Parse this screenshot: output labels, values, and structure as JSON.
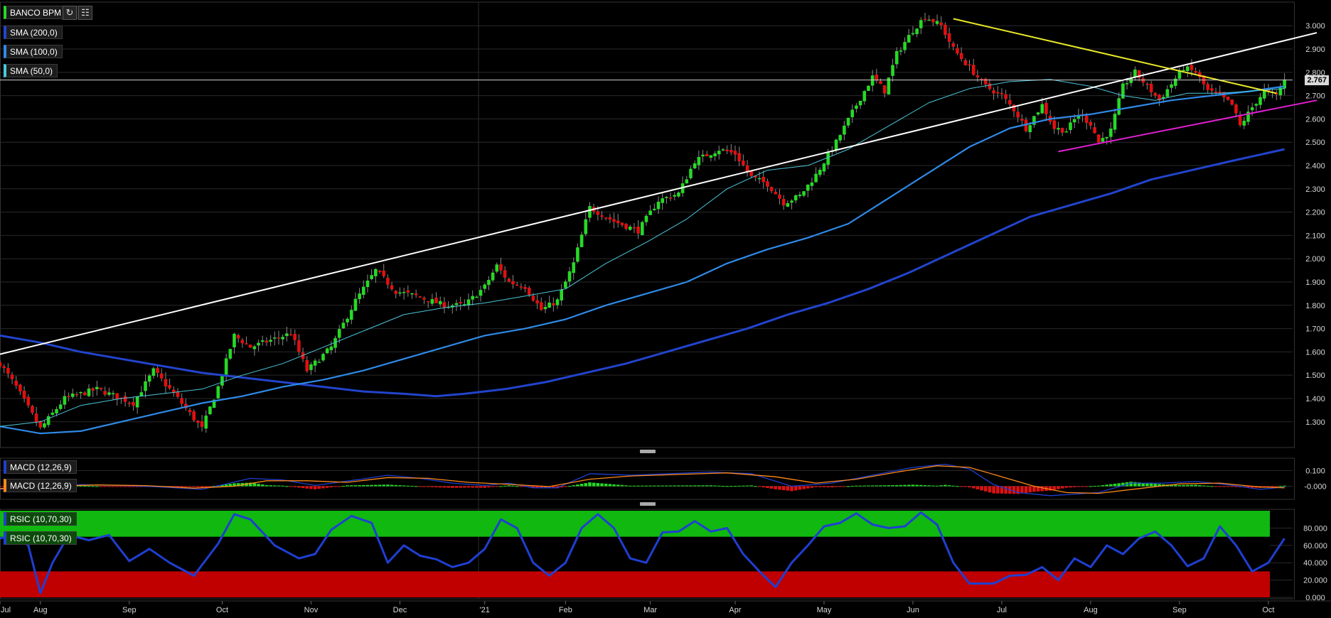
{
  "instrument": "BANCO BPM",
  "indicators": {
    "sma200": "SMA (200,0)",
    "sma100": "SMA (100,0)",
    "sma50": "SMA (50,0)",
    "macd_a": "MACD (12,26,9)",
    "macd_b": "MACD (12,26,9)",
    "rsi_a": "RSIC (10,70,30)",
    "rsi_b": "RSIC (10,70,30)"
  },
  "toolbar": {
    "refresh_icon": "refresh-icon",
    "chart_icon": "bar-chart-icon"
  },
  "last_price": "2.767",
  "colors": {
    "background": "#000000",
    "grid": "#2a2a2a",
    "up": "#26d926",
    "down": "#e01010",
    "sma50": "#4cc7d9",
    "sma100": "#2f8ae8",
    "sma200": "#2244cc",
    "trend_white": "#ffffff",
    "trend_yellow": "#e8e82a",
    "trend_magenta": "#e020d0",
    "macd": "#1f3fd1",
    "signal": "#ff8a1a",
    "rsi": "#1f3fd1",
    "rsi_overbought": "#10b810",
    "rsi_oversold": "#c00000"
  },
  "chart_data": [
    {
      "type": "candlestick",
      "title": "BANCO BPM",
      "ylim": [
        1.22,
        3.08
      ],
      "yticks": [
        "1.300",
        "1.400",
        "1.500",
        "1.600",
        "1.700",
        "1.800",
        "1.900",
        "2.000",
        "2.100",
        "2.200",
        "2.300",
        "2.400",
        "2.500",
        "2.600",
        "2.700",
        "2.800",
        "2.900",
        "3.000"
      ],
      "xticks": [
        "Jul",
        "Aug",
        "Sep",
        "Oct",
        "Nov",
        "Dec",
        "'21",
        "Feb",
        "Mar",
        "Apr",
        "May",
        "Jun",
        "Jul",
        "Aug",
        "Sep",
        "Oct"
      ],
      "x_range": [
        0,
        320
      ],
      "xtick_positions": [
        0,
        10,
        32,
        55,
        77,
        99,
        120,
        140,
        161,
        182,
        204,
        226,
        248,
        270,
        292,
        314
      ],
      "anchors": [
        [
          0,
          1.55
        ],
        [
          4,
          1.45
        ],
        [
          10,
          1.27
        ],
        [
          16,
          1.4
        ],
        [
          24,
          1.44
        ],
        [
          33,
          1.38
        ],
        [
          38,
          1.52
        ],
        [
          44,
          1.4
        ],
        [
          50,
          1.27
        ],
        [
          54,
          1.45
        ],
        [
          58,
          1.67
        ],
        [
          62,
          1.62
        ],
        [
          67,
          1.65
        ],
        [
          72,
          1.68
        ],
        [
          76,
          1.52
        ],
        [
          82,
          1.62
        ],
        [
          88,
          1.82
        ],
        [
          93,
          1.95
        ],
        [
          98,
          1.86
        ],
        [
          103,
          1.84
        ],
        [
          110,
          1.8
        ],
        [
          115,
          1.8
        ],
        [
          120,
          1.88
        ],
        [
          123,
          1.97
        ],
        [
          126,
          1.9
        ],
        [
          130,
          1.88
        ],
        [
          134,
          1.78
        ],
        [
          138,
          1.82
        ],
        [
          142,
          1.98
        ],
        [
          146,
          2.22
        ],
        [
          152,
          2.16
        ],
        [
          158,
          2.12
        ],
        [
          163,
          2.25
        ],
        [
          168,
          2.28
        ],
        [
          172,
          2.42
        ],
        [
          178,
          2.47
        ],
        [
          182,
          2.45
        ],
        [
          186,
          2.35
        ],
        [
          190,
          2.32
        ],
        [
          194,
          2.24
        ],
        [
          198,
          2.27
        ],
        [
          202,
          2.36
        ],
        [
          207,
          2.5
        ],
        [
          212,
          2.66
        ],
        [
          216,
          2.78
        ],
        [
          219,
          2.72
        ],
        [
          222,
          2.88
        ],
        [
          226,
          2.98
        ],
        [
          229,
          3.04
        ],
        [
          233,
          3.0
        ],
        [
          236,
          2.9
        ],
        [
          240,
          2.82
        ],
        [
          244,
          2.74
        ],
        [
          248,
          2.7
        ],
        [
          251,
          2.64
        ],
        [
          254,
          2.56
        ],
        [
          258,
          2.66
        ],
        [
          261,
          2.56
        ],
        [
          264,
          2.55
        ],
        [
          267,
          2.62
        ],
        [
          270,
          2.58
        ],
        [
          272,
          2.5
        ],
        [
          275,
          2.55
        ],
        [
          278,
          2.74
        ],
        [
          281,
          2.8
        ],
        [
          284,
          2.74
        ],
        [
          287,
          2.68
        ],
        [
          290,
          2.75
        ],
        [
          293,
          2.82
        ],
        [
          296,
          2.8
        ],
        [
          299,
          2.72
        ],
        [
          302,
          2.7
        ],
        [
          305,
          2.66
        ],
        [
          307,
          2.57
        ],
        [
          310,
          2.65
        ],
        [
          313,
          2.72
        ],
        [
          316,
          2.7
        ],
        [
          318,
          2.767
        ]
      ],
      "sma50_points": [
        [
          0,
          1.28
        ],
        [
          10,
          1.3
        ],
        [
          20,
          1.37
        ],
        [
          30,
          1.4
        ],
        [
          40,
          1.42
        ],
        [
          50,
          1.44
        ],
        [
          60,
          1.5
        ],
        [
          70,
          1.55
        ],
        [
          80,
          1.62
        ],
        [
          90,
          1.69
        ],
        [
          100,
          1.76
        ],
        [
          110,
          1.79
        ],
        [
          120,
          1.81
        ],
        [
          130,
          1.84
        ],
        [
          140,
          1.87
        ],
        [
          150,
          1.98
        ],
        [
          160,
          2.07
        ],
        [
          170,
          2.17
        ],
        [
          180,
          2.3
        ],
        [
          190,
          2.38
        ],
        [
          200,
          2.4
        ],
        [
          210,
          2.47
        ],
        [
          220,
          2.57
        ],
        [
          230,
          2.67
        ],
        [
          240,
          2.73
        ],
        [
          250,
          2.76
        ],
        [
          260,
          2.77
        ],
        [
          270,
          2.74
        ],
        [
          278,
          2.7
        ],
        [
          286,
          2.68
        ],
        [
          294,
          2.71
        ],
        [
          302,
          2.71
        ],
        [
          310,
          2.72
        ],
        [
          318,
          2.73
        ]
      ],
      "sma100_points": [
        [
          0,
          1.28
        ],
        [
          10,
          1.25
        ],
        [
          20,
          1.26
        ],
        [
          30,
          1.3
        ],
        [
          40,
          1.34
        ],
        [
          50,
          1.38
        ],
        [
          60,
          1.41
        ],
        [
          70,
          1.45
        ],
        [
          80,
          1.48
        ],
        [
          90,
          1.52
        ],
        [
          100,
          1.57
        ],
        [
          110,
          1.62
        ],
        [
          120,
          1.67
        ],
        [
          130,
          1.7
        ],
        [
          140,
          1.74
        ],
        [
          150,
          1.8
        ],
        [
          160,
          1.85
        ],
        [
          170,
          1.9
        ],
        [
          180,
          1.98
        ],
        [
          190,
          2.04
        ],
        [
          200,
          2.09
        ],
        [
          210,
          2.15
        ],
        [
          220,
          2.26
        ],
        [
          230,
          2.37
        ],
        [
          240,
          2.48
        ],
        [
          250,
          2.56
        ],
        [
          260,
          2.6
        ],
        [
          270,
          2.62
        ],
        [
          280,
          2.65
        ],
        [
          290,
          2.68
        ],
        [
          300,
          2.7
        ],
        [
          310,
          2.72
        ],
        [
          318,
          2.74
        ]
      ],
      "sma200_points": [
        [
          0,
          1.67
        ],
        [
          10,
          1.64
        ],
        [
          20,
          1.6
        ],
        [
          30,
          1.57
        ],
        [
          40,
          1.54
        ],
        [
          50,
          1.51
        ],
        [
          60,
          1.49
        ],
        [
          70,
          1.47
        ],
        [
          80,
          1.45
        ],
        [
          90,
          1.43
        ],
        [
          100,
          1.42
        ],
        [
          108,
          1.41
        ],
        [
          115,
          1.42
        ],
        [
          125,
          1.44
        ],
        [
          135,
          1.47
        ],
        [
          145,
          1.51
        ],
        [
          155,
          1.55
        ],
        [
          165,
          1.6
        ],
        [
          175,
          1.65
        ],
        [
          185,
          1.7
        ],
        [
          195,
          1.76
        ],
        [
          205,
          1.81
        ],
        [
          215,
          1.87
        ],
        [
          225,
          1.94
        ],
        [
          235,
          2.02
        ],
        [
          245,
          2.1
        ],
        [
          255,
          2.18
        ],
        [
          265,
          2.23
        ],
        [
          275,
          2.28
        ],
        [
          285,
          2.34
        ],
        [
          295,
          2.38
        ],
        [
          305,
          2.42
        ],
        [
          318,
          2.47
        ]
      ],
      "trendlines": [
        {
          "color": "white",
          "from": [
            0,
            1.59
          ],
          "to": [
            326,
            2.97
          ]
        },
        {
          "color": "yellow",
          "from": [
            236,
            3.03
          ],
          "to": [
            316,
            2.71
          ]
        },
        {
          "color": "magenta",
          "from": [
            262,
            2.46
          ],
          "to": [
            326,
            2.68
          ]
        }
      ],
      "price_line": 2.767
    },
    {
      "type": "histogram",
      "title": "MACD (12,26,9)",
      "yticks": [
        "0.100",
        "-0.000"
      ],
      "ylim": [
        -0.07,
        0.165
      ],
      "macd_anchors": [
        [
          0,
          -0.02
        ],
        [
          10,
          0.005
        ],
        [
          20,
          0.01
        ],
        [
          30,
          0.005
        ],
        [
          40,
          -0.005
        ],
        [
          50,
          -0.02
        ],
        [
          56,
          0.015
        ],
        [
          62,
          0.05
        ],
        [
          70,
          0.04
        ],
        [
          78,
          0.005
        ],
        [
          88,
          0.04
        ],
        [
          96,
          0.07
        ],
        [
          104,
          0.05
        ],
        [
          112,
          0.02
        ],
        [
          120,
          0.005
        ],
        [
          126,
          0.02
        ],
        [
          132,
          -0.01
        ],
        [
          138,
          -0.01
        ],
        [
          146,
          0.08
        ],
        [
          156,
          0.07
        ],
        [
          166,
          0.08
        ],
        [
          176,
          0.09
        ],
        [
          186,
          0.08
        ],
        [
          196,
          0.0
        ],
        [
          206,
          0.02
        ],
        [
          216,
          0.07
        ],
        [
          226,
          0.12
        ],
        [
          234,
          0.14
        ],
        [
          240,
          0.11
        ],
        [
          246,
          0.01
        ],
        [
          252,
          -0.04
        ],
        [
          260,
          -0.06
        ],
        [
          266,
          -0.05
        ],
        [
          272,
          -0.04
        ],
        [
          280,
          0.02
        ],
        [
          288,
          0.02
        ],
        [
          296,
          0.03
        ],
        [
          304,
          0.01
        ],
        [
          312,
          -0.02
        ],
        [
          318,
          -0.005
        ]
      ],
      "signal_anchors": [
        [
          0,
          -0.015
        ],
        [
          12,
          0.0
        ],
        [
          24,
          0.008
        ],
        [
          36,
          0.004
        ],
        [
          48,
          -0.012
        ],
        [
          58,
          0.0
        ],
        [
          66,
          0.035
        ],
        [
          76,
          0.035
        ],
        [
          86,
          0.025
        ],
        [
          96,
          0.055
        ],
        [
          106,
          0.05
        ],
        [
          116,
          0.025
        ],
        [
          126,
          0.012
        ],
        [
          136,
          -0.002
        ],
        [
          146,
          0.045
        ],
        [
          156,
          0.065
        ],
        [
          168,
          0.075
        ],
        [
          180,
          0.085
        ],
        [
          192,
          0.06
        ],
        [
          202,
          0.02
        ],
        [
          212,
          0.045
        ],
        [
          222,
          0.09
        ],
        [
          232,
          0.13
        ],
        [
          240,
          0.12
        ],
        [
          248,
          0.06
        ],
        [
          256,
          0.0
        ],
        [
          264,
          -0.04
        ],
        [
          272,
          -0.045
        ],
        [
          282,
          -0.015
        ],
        [
          292,
          0.015
        ],
        [
          302,
          0.02
        ],
        [
          312,
          -0.005
        ],
        [
          318,
          -0.01
        ]
      ]
    },
    {
      "type": "line",
      "title": "RSIC (10,70,30)",
      "ylim": [
        0,
        100
      ],
      "yticks": [
        "0.000",
        "20.000",
        "40.000",
        "60.000",
        "80.000"
      ],
      "overbought": 70,
      "oversold": 30,
      "rsi_anchors": [
        [
          0,
          68
        ],
        [
          3,
          72
        ],
        [
          7,
          60
        ],
        [
          10,
          5
        ],
        [
          13,
          40
        ],
        [
          17,
          72
        ],
        [
          22,
          66
        ],
        [
          27,
          72
        ],
        [
          32,
          42
        ],
        [
          37,
          56
        ],
        [
          42,
          40
        ],
        [
          48,
          25
        ],
        [
          54,
          62
        ],
        [
          58,
          96
        ],
        [
          62,
          90
        ],
        [
          68,
          60
        ],
        [
          74,
          45
        ],
        [
          78,
          50
        ],
        [
          82,
          78
        ],
        [
          87,
          94
        ],
        [
          92,
          86
        ],
        [
          96,
          40
        ],
        [
          100,
          60
        ],
        [
          104,
          48
        ],
        [
          108,
          44
        ],
        [
          112,
          35
        ],
        [
          116,
          40
        ],
        [
          120,
          56
        ],
        [
          124,
          90
        ],
        [
          128,
          80
        ],
        [
          132,
          40
        ],
        [
          136,
          25
        ],
        [
          140,
          40
        ],
        [
          144,
          80
        ],
        [
          148,
          96
        ],
        [
          152,
          80
        ],
        [
          156,
          45
        ],
        [
          160,
          40
        ],
        [
          164,
          75
        ],
        [
          168,
          76
        ],
        [
          172,
          88
        ],
        [
          176,
          76
        ],
        [
          180,
          80
        ],
        [
          184,
          50
        ],
        [
          188,
          30
        ],
        [
          192,
          12
        ],
        [
          196,
          40
        ],
        [
          200,
          60
        ],
        [
          204,
          82
        ],
        [
          208,
          86
        ],
        [
          212,
          97
        ],
        [
          216,
          84
        ],
        [
          220,
          80
        ],
        [
          224,
          82
        ],
        [
          228,
          98
        ],
        [
          232,
          84
        ],
        [
          236,
          40
        ],
        [
          240,
          16
        ],
        [
          246,
          16
        ],
        [
          250,
          25
        ],
        [
          254,
          26
        ],
        [
          258,
          35
        ],
        [
          262,
          20
        ],
        [
          266,
          45
        ],
        [
          270,
          35
        ],
        [
          274,
          60
        ],
        [
          278,
          50
        ],
        [
          282,
          68
        ],
        [
          286,
          76
        ],
        [
          290,
          60
        ],
        [
          294,
          36
        ],
        [
          298,
          45
        ],
        [
          302,
          82
        ],
        [
          306,
          60
        ],
        [
          310,
          30
        ],
        [
          314,
          40
        ],
        [
          318,
          68
        ]
      ]
    }
  ]
}
